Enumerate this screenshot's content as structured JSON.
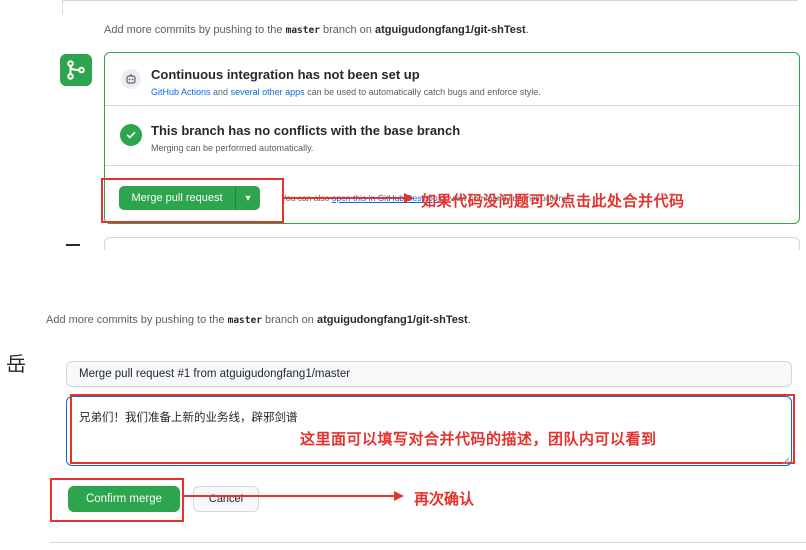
{
  "top_hint": {
    "prefix": "Add more commits by pushing to the ",
    "branch": "master",
    "middle": " branch on ",
    "repo": "atguigudongfang1/git-shTest",
    "suffix": "."
  },
  "ci": {
    "title": "Continuous integration has not been set up",
    "link1": "GitHub Actions",
    "and": " and ",
    "link2": "several other apps",
    "rest": " can be used to automatically catch bugs and enforce style."
  },
  "no_conflicts": {
    "title": "This branch has no conflicts with the base branch",
    "desc": "Merging can be performed automatically."
  },
  "merge_button": {
    "label": "Merge pull request",
    "caret": "▾"
  },
  "alt_options": {
    "prefix": "You can also ",
    "link": "open this in GitHub Desktop",
    "suffix": " or view command line instructions."
  },
  "annotations": {
    "merge": "如果代码没问题可以点击此处合并代码",
    "description": "这里面可以填写对合并代码的描述，团队内可以看到",
    "confirm": "再次确认"
  },
  "bottom_hint": {
    "prefix": "Add more commits by pushing to the ",
    "branch": "master",
    "middle": " branch on ",
    "repo": "atguigudongfang1/git-shTest",
    "suffix": "."
  },
  "side_char": "岳",
  "commit_form": {
    "title_value": "Merge pull request #1 from atguigudongfang1/master",
    "message_value": "兄弟们！我们准备上新的业务线，辟邪剑谱"
  },
  "confirm_button": "Confirm merge",
  "cancel_button": "Cancel",
  "colors": {
    "green": "#2da44e",
    "annotation_red": "#e5322d",
    "link_blue": "#0969da"
  }
}
